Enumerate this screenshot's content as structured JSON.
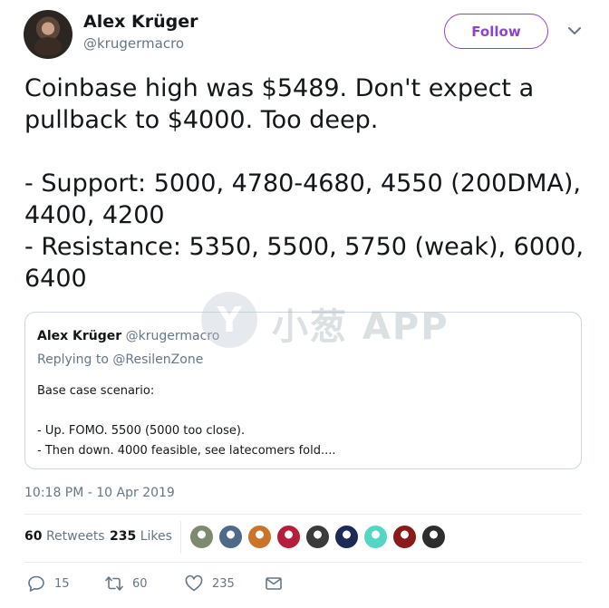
{
  "author": {
    "name": "Alex Krüger",
    "handle": "@krugermacro",
    "follow_label": "Follow",
    "avatar_icon": "profile-photo"
  },
  "tweet": {
    "lines": [
      "Coinbase high was $5489. Don't expect a",
      "pullback to $4000. Too deep.",
      "",
      "- Support: 5000, 4780-4680, 4550 (200DMA),",
      "4400, 4200",
      "- Resistance: 5350, 5500, 5750 (weak), 6000,",
      "6400"
    ],
    "timestamp": "10:18 PM - 10 Apr 2019"
  },
  "watermark": {
    "logo_glyph": "Y",
    "text": "小葱 APP"
  },
  "quoted": {
    "name": "Alex Krüger",
    "handle": "@krugermacro",
    "replying_prefix": "Replying to",
    "replying_to": "@ResilenZone",
    "lines": [
      "Base case scenario:",
      "",
      "- Up. FOMO. 5500 (5000 too close).",
      "- Then down. 4000 feasible, see latecomers fold...."
    ]
  },
  "stats": {
    "retweets_count": "60",
    "retweets_label": "Retweets",
    "likes_count": "235",
    "likes_label": "Likes",
    "liker_avatar_colors": [
      "#7d8a6f",
      "#4f6a86",
      "#c9742a",
      "#b71e3c",
      "#3b3b3b",
      "#1c2a55",
      "#55d6c5",
      "#8b1a1a",
      "#2d2d2d"
    ]
  },
  "actions": {
    "reply_count": "15",
    "retweet_count": "60",
    "like_count": "235",
    "icons": [
      "reply-icon",
      "retweet-icon",
      "like-icon",
      "message-icon"
    ]
  },
  "colors": {
    "accent": "#8e44c9",
    "secondary_text": "#657786",
    "border": "#ccd6dd"
  }
}
